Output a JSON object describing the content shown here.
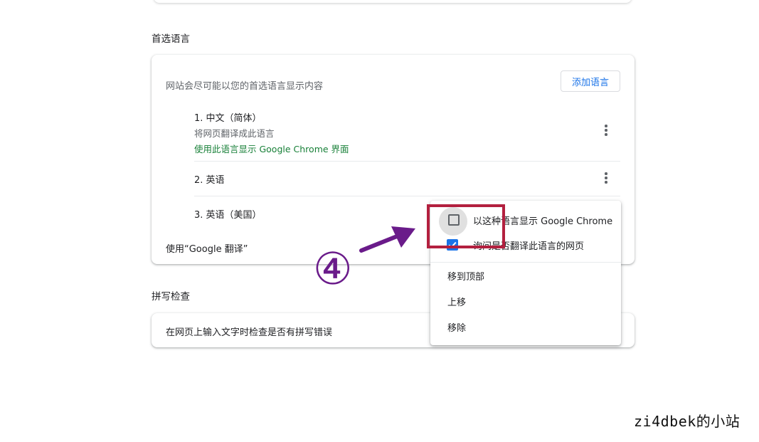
{
  "preferred_languages": {
    "section_title": "首选语言",
    "description": "网站会尽可能以您的首选语言显示内容",
    "add_button": "添加语言",
    "items": [
      {
        "name": "1. 中文（简体）",
        "subtitle": "将网页翻译成此语言",
        "ui_note": "使用此语言显示 Google Chrome 界面"
      },
      {
        "name": "2. 英语"
      },
      {
        "name": "3. 英语（美国）"
      }
    ],
    "translate_label": "使用“Google 翻译”"
  },
  "spell_check": {
    "section_title": "拼写检查",
    "row_text": "在网页上输入文字时检查是否有拼写错误"
  },
  "context_menu": {
    "items": [
      {
        "label": "以这种语言显示 Google Chrome",
        "type": "checkbox",
        "checked": false
      },
      {
        "label": "询问是否翻译此语言的网页",
        "type": "checkbox",
        "checked": true
      },
      {
        "label": "移到顶部",
        "type": "action"
      },
      {
        "label": "上移",
        "type": "action"
      },
      {
        "label": "移除",
        "type": "action"
      }
    ]
  },
  "annotation": {
    "step_number": "④",
    "colors": {
      "highlight_box": "#b3203f",
      "arrow": "#6a1b8a",
      "accent": "#1a73e8",
      "ui_language_note": "#188038"
    }
  },
  "watermark": "zi4dbek的小站"
}
